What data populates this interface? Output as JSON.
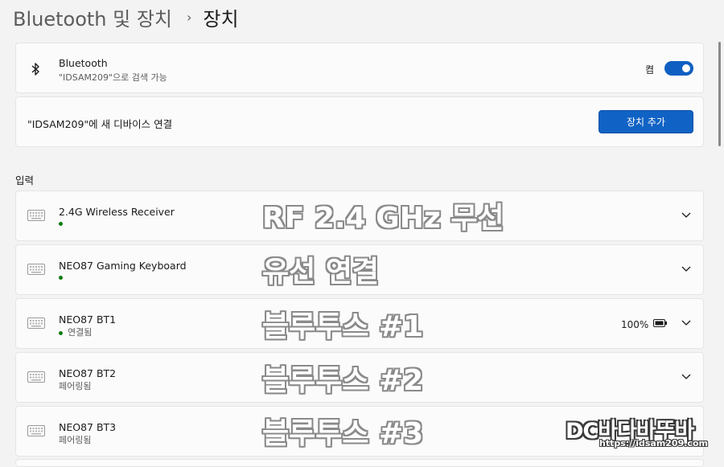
{
  "breadcrumb": {
    "parent": "Bluetooth 및 장치",
    "separator": "›",
    "current": "장치"
  },
  "bluetooth_card": {
    "icon": "bluetooth-icon",
    "title": "Bluetooth",
    "subtitle": "\"IDSAM209\"으로 검색 가능",
    "toggle_label": "켬",
    "toggle_on": true,
    "toggle_color": "#0f5fc2"
  },
  "add_device_card": {
    "text": "\"IDSAM209\"에 새 디바이스 연결",
    "button_label": "장치 추가",
    "button_color": "#1062c4"
  },
  "section_label": "입력",
  "devices": [
    {
      "name": "2.4G Wireless Receiver",
      "status": "",
      "status_dot": true,
      "battery": ""
    },
    {
      "name": "NEO87 Gaming Keyboard",
      "status": "",
      "status_dot": true,
      "battery": ""
    },
    {
      "name": "NEO87 BT1",
      "status": "연결됨",
      "status_dot": true,
      "battery": "100%"
    },
    {
      "name": "NEO87 BT2",
      "status": "페어링됨",
      "status_dot": false,
      "battery": ""
    },
    {
      "name": "NEO87 BT3",
      "status": "페어링됨",
      "status_dot": false,
      "battery": ""
    }
  ],
  "overlays": [
    "RF 2.4 GHz 무선",
    "유선 연결",
    "블루투스 #1",
    "블루투스 #2",
    "블루투스 #3"
  ],
  "watermark": {
    "brand": "DC바다바뚜바",
    "url": "https://idsam209.com"
  },
  "status_dot_color": "#0e7c10"
}
